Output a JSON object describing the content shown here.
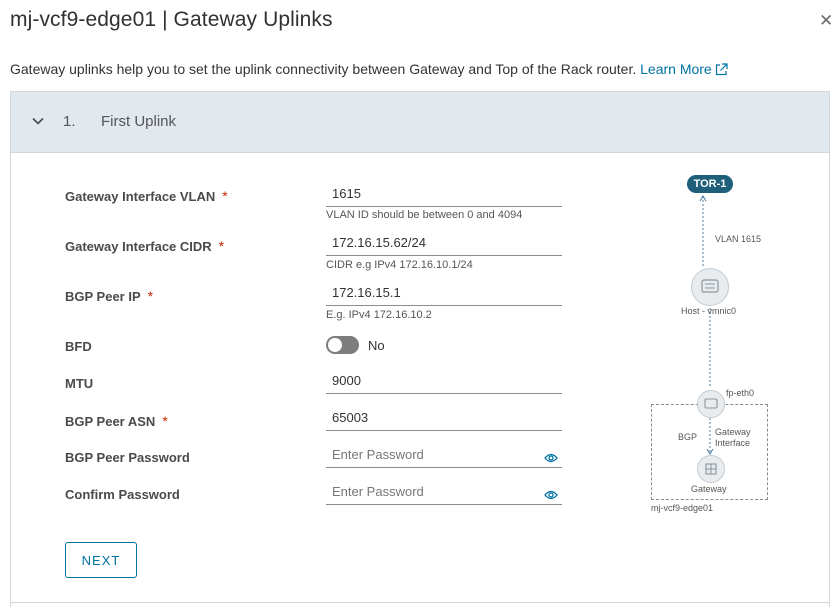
{
  "dialog": {
    "title": "mj-vcf9-edge01 | Gateway Uplinks",
    "close_icon": "close-icon"
  },
  "intro": {
    "text": "Gateway uplinks help you to set the uplink connectivity between Gateway and Top of the Rack router.",
    "link": "Learn More",
    "link_icon": "external-link-icon"
  },
  "step": {
    "number": "1.",
    "title": "First Uplink",
    "expand_icon": "chevron-down-icon"
  },
  "fields": {
    "vlan": {
      "label": "Gateway Interface VLAN",
      "value": "1615",
      "hint": "VLAN ID should be between 0 and 4094"
    },
    "cidr": {
      "label": "Gateway Interface CIDR",
      "value": "172.16.15.62/24",
      "hint": "CIDR e.g IPv4 172.16.10.1/24"
    },
    "peer_ip": {
      "label": "BGP Peer IP",
      "value": "172.16.15.1",
      "hint": "E.g. IPv4 172.16.10.2"
    },
    "bfd": {
      "label": "BFD",
      "state": "No"
    },
    "mtu": {
      "label": "MTU",
      "value": "9000"
    },
    "asn": {
      "label": "BGP Peer ASN",
      "value": "65003"
    },
    "password": {
      "label": "BGP Peer Password",
      "placeholder": "Enter Password"
    },
    "confirm": {
      "label": "Confirm Password",
      "placeholder": "Enter Password"
    },
    "required_mark": "*"
  },
  "actions": {
    "next": "NEXT"
  },
  "diagram": {
    "tor": "TOR-1",
    "vlan": "VLAN 1615",
    "host": "Host - vmnic0",
    "fp": "fp-eth0",
    "bgp": "BGP",
    "gw_interface_1": "Gateway",
    "gw_interface_2": "Interface",
    "gateway": "Gateway",
    "edge": "mj-vcf9-edge01"
  },
  "colors": {
    "accent": "#0072a3",
    "required": "#c92100",
    "header_bg": "#e1e8ee",
    "tor_badge": "#1f5f7a"
  }
}
